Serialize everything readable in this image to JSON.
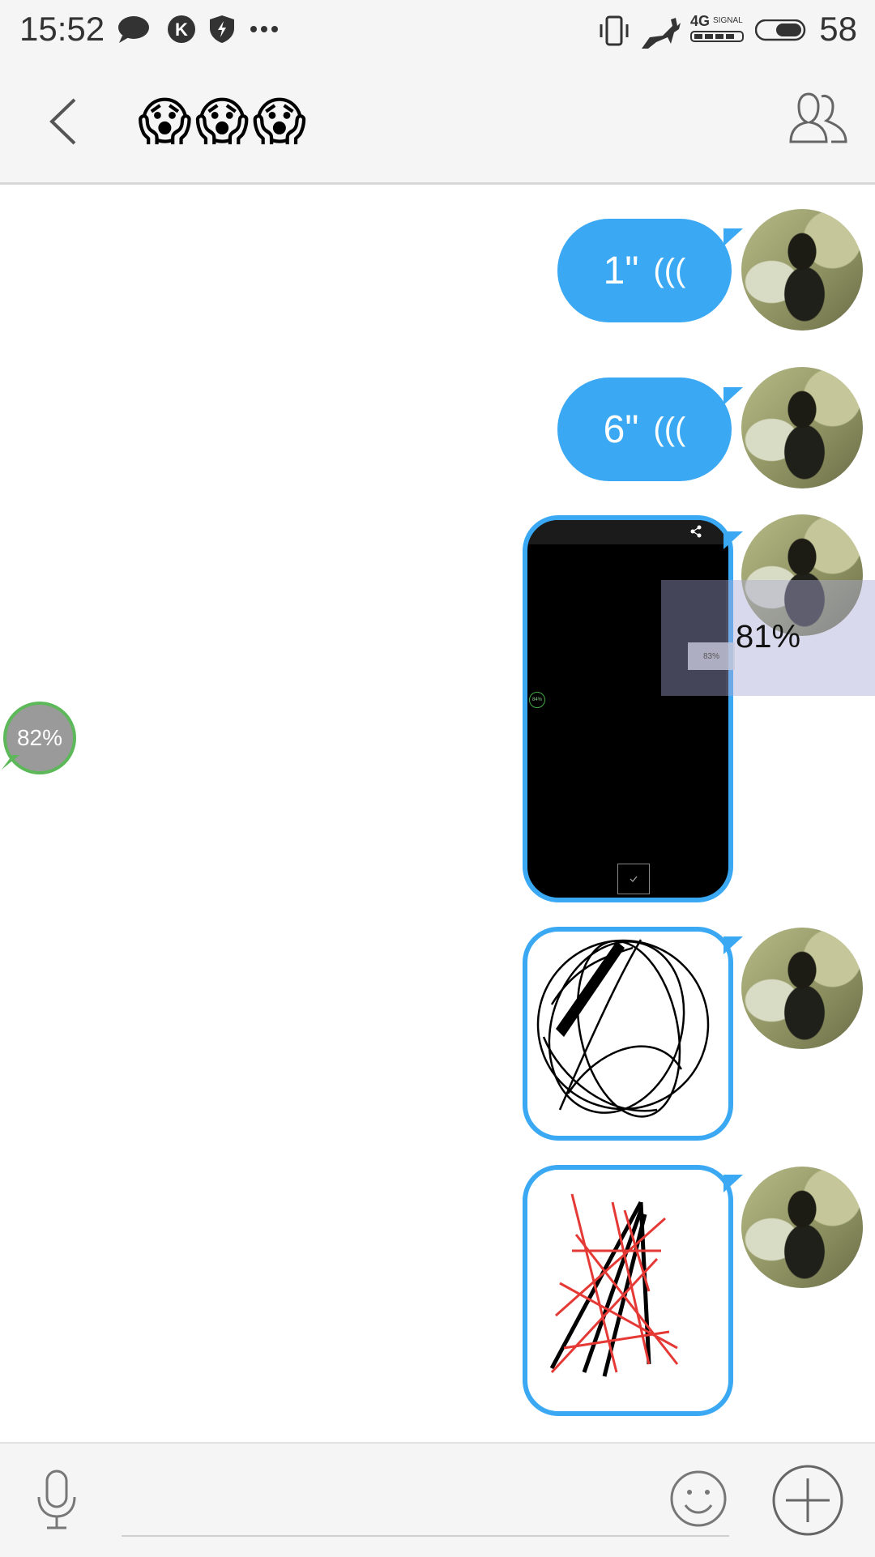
{
  "status_bar": {
    "time": "15:52",
    "network_label": "4G",
    "signal_label": "SIGNAL",
    "battery": "58"
  },
  "header": {
    "title": "😱😱😱"
  },
  "messages": [
    {
      "type": "voice",
      "duration": "1\"",
      "wave": "(((",
      "sent": true
    },
    {
      "type": "voice",
      "duration": "6\"",
      "wave": "(((",
      "sent": true
    },
    {
      "type": "image",
      "description": "screenshot",
      "sent": true
    },
    {
      "type": "image",
      "description": "black-scribble",
      "sent": true
    },
    {
      "type": "image",
      "description": "red-black-scribble",
      "sent": true
    }
  ],
  "upload_overlay": {
    "label": "81%",
    "inner_label": "83%",
    "fraction": 0.81
  },
  "side_progress": {
    "label": "82%",
    "fraction": 0.82
  },
  "screenshot_small_label": "84%",
  "colors": {
    "bubble": "#3aa8f3",
    "header_bg": "#f5f5f5",
    "progress_ring": "#5db85a"
  },
  "icons": [
    "back-icon",
    "group-icon",
    "mic-icon",
    "emoji-icon",
    "plus-icon"
  ]
}
